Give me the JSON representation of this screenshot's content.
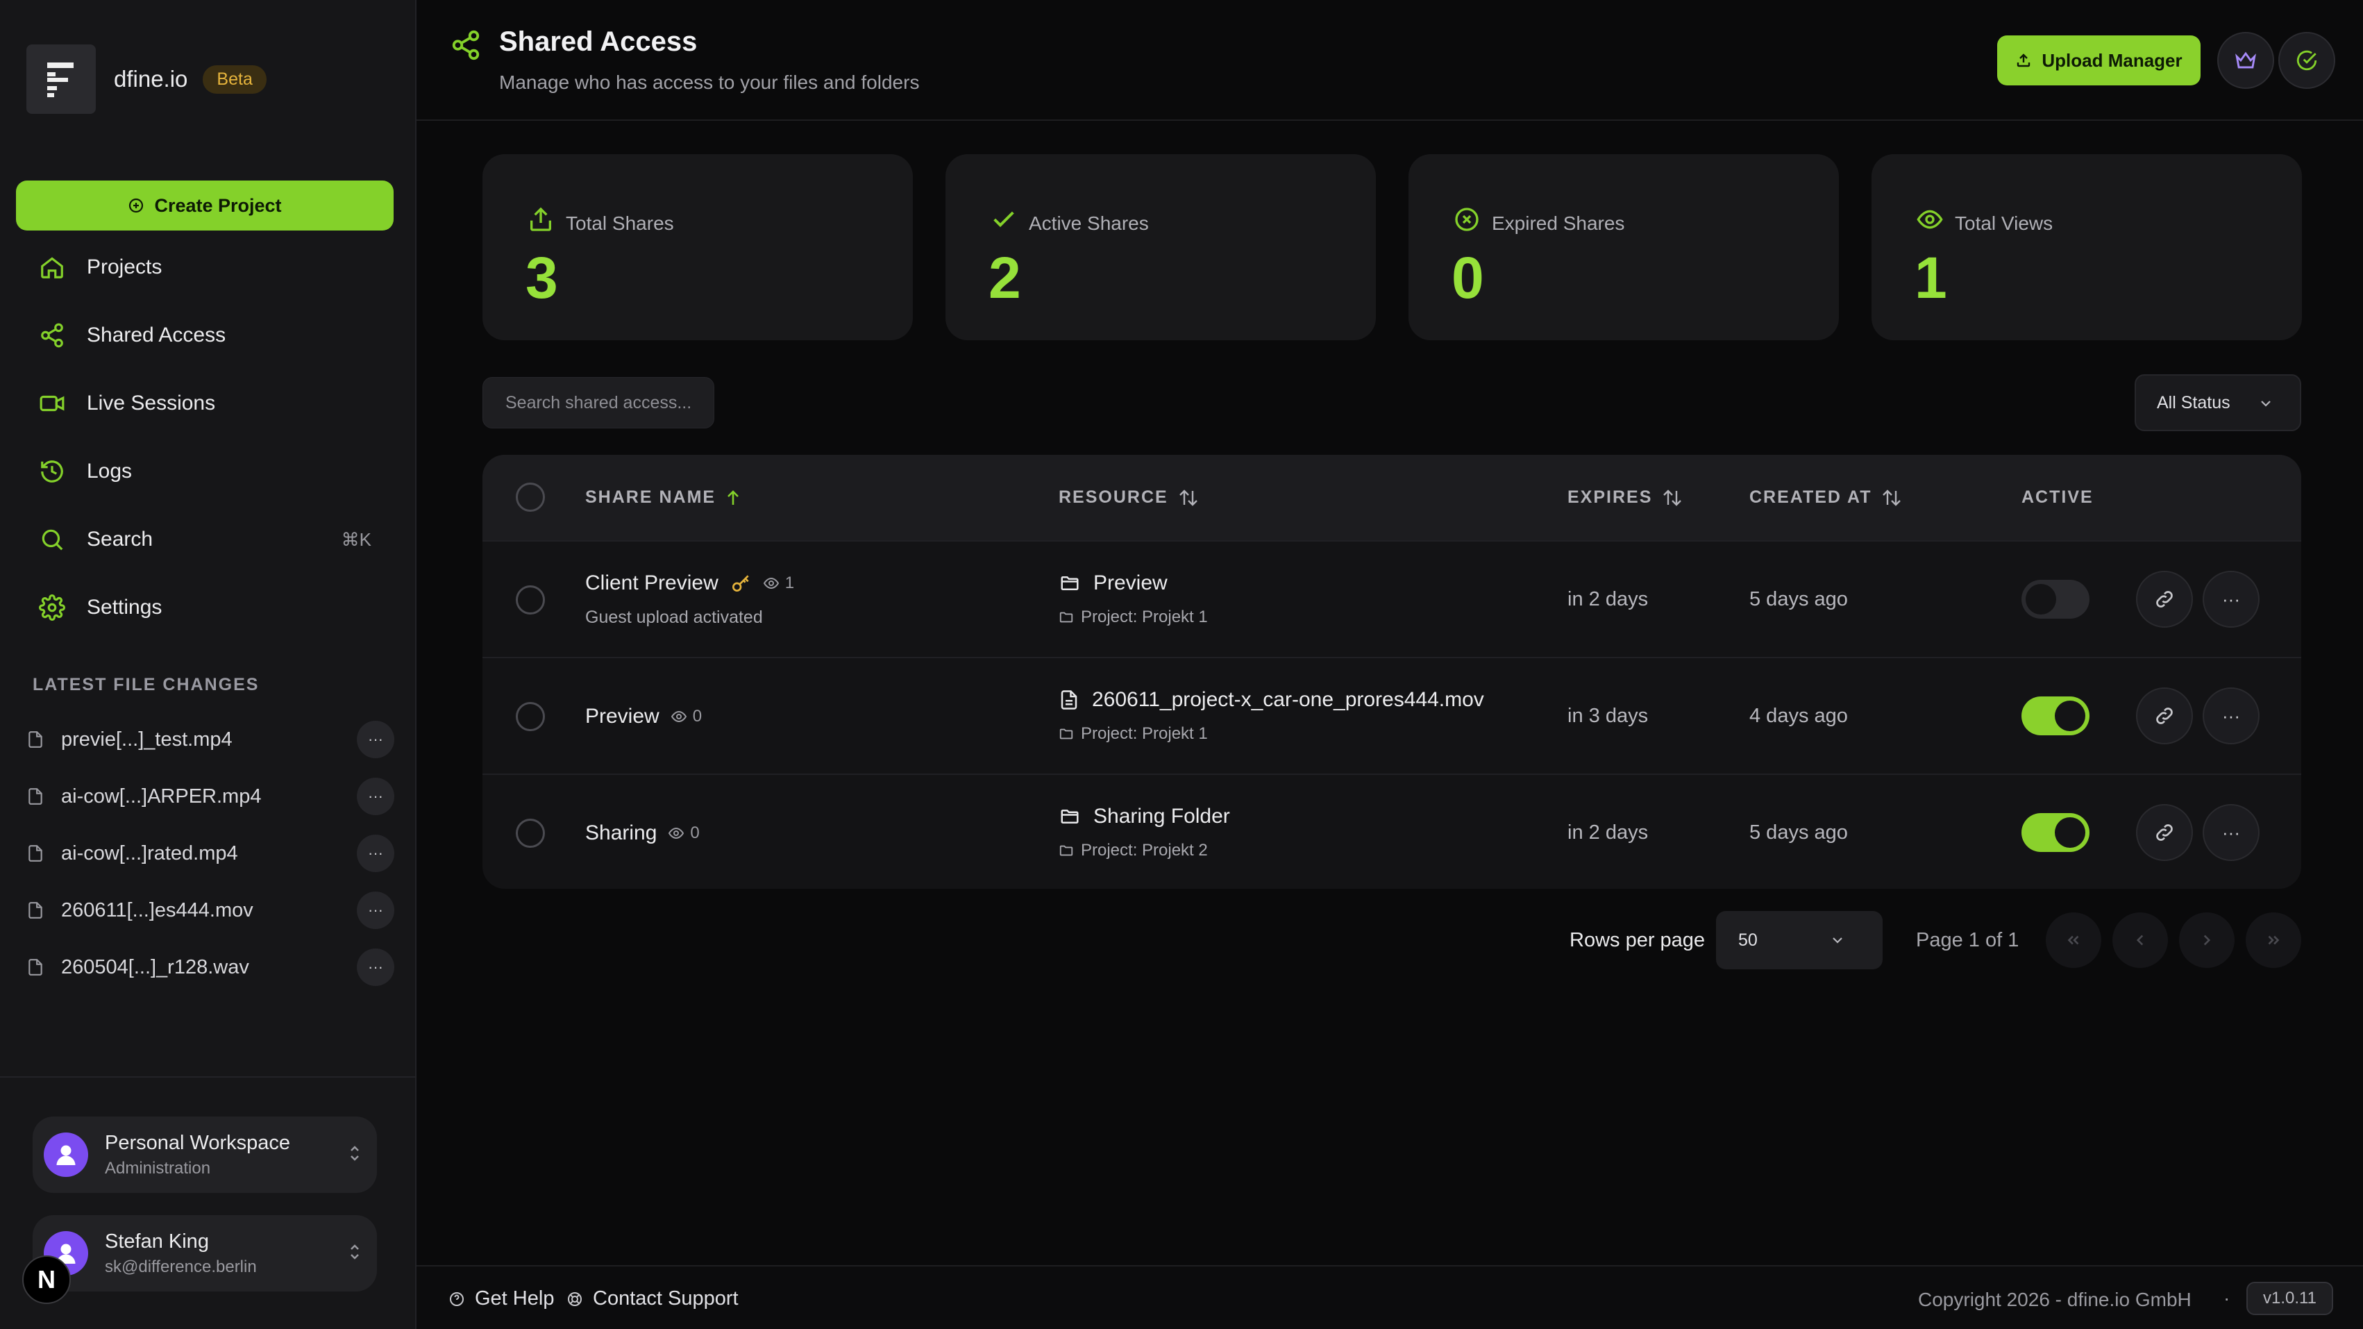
{
  "brand": {
    "name": "dfine.io",
    "badge": "Beta"
  },
  "sidebar": {
    "create_label": "Create Project",
    "items": [
      {
        "label": "Projects",
        "icon": "home-icon"
      },
      {
        "label": "Shared Access",
        "icon": "share-icon",
        "active": true
      },
      {
        "label": "Live Sessions",
        "icon": "video-icon"
      },
      {
        "label": "Logs",
        "icon": "history-icon"
      },
      {
        "label": "Search",
        "icon": "search-icon",
        "shortcut": "⌘K"
      },
      {
        "label": "Settings",
        "icon": "gear-icon"
      }
    ],
    "files_heading": "LATEST FILE CHANGES",
    "files": [
      {
        "name": "previe[...]_test.mp4"
      },
      {
        "name": "ai-cow[...]ARPER.mp4"
      },
      {
        "name": "ai-cow[...]rated.mp4"
      },
      {
        "name": "260611[...]es444.mov"
      },
      {
        "name": "260504[...]_r128.wav"
      }
    ],
    "more_label": "···",
    "workspace": {
      "title": "Personal Workspace",
      "subtitle": "Administration"
    },
    "user": {
      "name": "Stefan King",
      "email": "sk@difference.berlin"
    },
    "n_badge": "N"
  },
  "header": {
    "title": "Shared Access",
    "subtitle": "Manage who has access to your files and folders",
    "upload_label": "Upload Manager"
  },
  "stats": [
    {
      "label": "Total Shares",
      "value": "3",
      "icon": "upload-icon"
    },
    {
      "label": "Active Shares",
      "value": "2",
      "icon": "check-icon"
    },
    {
      "label": "Expired Shares",
      "value": "0",
      "icon": "x-circle-icon"
    },
    {
      "label": "Total Views",
      "value": "1",
      "icon": "eye-icon"
    }
  ],
  "toolbar": {
    "search_placeholder": "Search shared access...",
    "status_filter": "All Status"
  },
  "table": {
    "columns": {
      "share_name": "SHARE NAME",
      "resource": "RESOURCE",
      "expires": "EXPIRES",
      "created_at": "CREATED AT",
      "active": "ACTIVE"
    },
    "rows": [
      {
        "name": "Client Preview",
        "views": "1",
        "has_key": true,
        "subtitle": "Guest upload activated",
        "resource": "Preview",
        "resource_type": "folder",
        "project": "Project: Projekt 1",
        "expires": "in 2 days",
        "created": "5 days ago",
        "active": false
      },
      {
        "name": "Preview",
        "views": "0",
        "has_key": false,
        "subtitle": "",
        "resource": "260611_project-x_car-one_prores444.mov",
        "resource_type": "file",
        "project": "Project: Projekt 1",
        "expires": "in 3 days",
        "created": "4 days ago",
        "active": true
      },
      {
        "name": "Sharing",
        "views": "0",
        "has_key": false,
        "subtitle": "",
        "resource": "Sharing Folder",
        "resource_type": "folder",
        "project": "Project: Projekt 2",
        "expires": "in 2 days",
        "created": "5 days ago",
        "active": true
      }
    ],
    "more_label": "···"
  },
  "pagination": {
    "rows_label": "Rows per page",
    "rows_value": "50",
    "page_info": "Page 1 of 1"
  },
  "footer": {
    "help": "Get Help",
    "support": "Contact Support",
    "copyright": "Copyright 2026 - dfine.io GmbH",
    "separator": "·",
    "version": "v1.0.11"
  },
  "colors": {
    "accent": "#8ad12c",
    "stat_value": "#96e13a",
    "beta": "#e6b43c",
    "avatar": "#7b4cf0"
  }
}
